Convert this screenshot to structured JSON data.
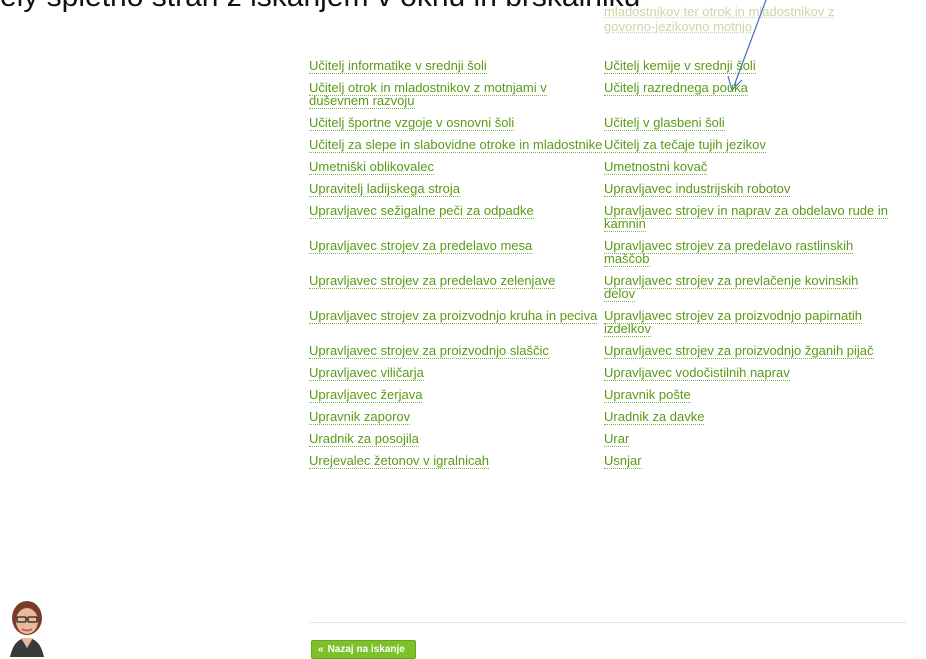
{
  "heading_text": "ely spletno stran z iskanjem v oknu in brskalniku",
  "faded_top": [
    "mladostnikov ter otrok in mladostnikov z",
    "govorno-jezikovno motnjo"
  ],
  "rows": [
    [
      "Učitelj informatike v srednji šoli",
      "Učitelj kemije v srednji šoli"
    ],
    [
      "Učitelj otrok in mladostnikov z motnjami v duševnem razvoju",
      "Učitelj razrednega pouka"
    ],
    [
      "Učitelj športne vzgoje v osnovni šoli",
      "Učitelj v glasbeni šoli"
    ],
    [
      "Učitelj za slepe in slabovidne otroke in mladostnike",
      "Učitelj za tečaje tujih jezikov"
    ],
    [
      "Umetniški oblikovalec",
      "Umetnostni kovač"
    ],
    [
      "Upravitelj ladijskega stroja",
      "Upravljavec industrijskih robotov"
    ],
    [
      "Upravljavec sežigalne peči za odpadke",
      "Upravljavec strojev in naprav za obdelavo rude in kamnin"
    ],
    [
      "Upravljavec strojev za predelavo mesa",
      "Upravljavec strojev za predelavo rastlinskih maščob"
    ],
    [
      "Upravljavec strojev za predelavo zelenjave",
      "Upravljavec strojev za prevlačenje kovinskih delov"
    ],
    [
      "Upravljavec strojev za proizvodnjo kruha in peciva",
      "Upravljavec strojev za proizvodnjo papirnatih izdelkov"
    ],
    [
      "Upravljavec strojev za proizvodnjo slaščic",
      "Upravljavec strojev za proizvodnjo žganih pijač"
    ],
    [
      "Upravljavec viličarja",
      "Upravljavec vodočistilnih naprav"
    ],
    [
      "Upravljavec žerjava",
      "Upravnik pošte"
    ],
    [
      "Upravnik zaporov",
      "Uradnik za davke"
    ],
    [
      "Uradnik za posojila",
      "Urar"
    ],
    [
      "Urejevalec žetonov v igralnicah",
      "Usnjar"
    ]
  ],
  "back_button": {
    "icon": "«",
    "label": "Nazaj na iskanje"
  },
  "colors": {
    "link": "#5a9a16",
    "button": "#7cc02a",
    "arrow": "#3c6fc4"
  }
}
